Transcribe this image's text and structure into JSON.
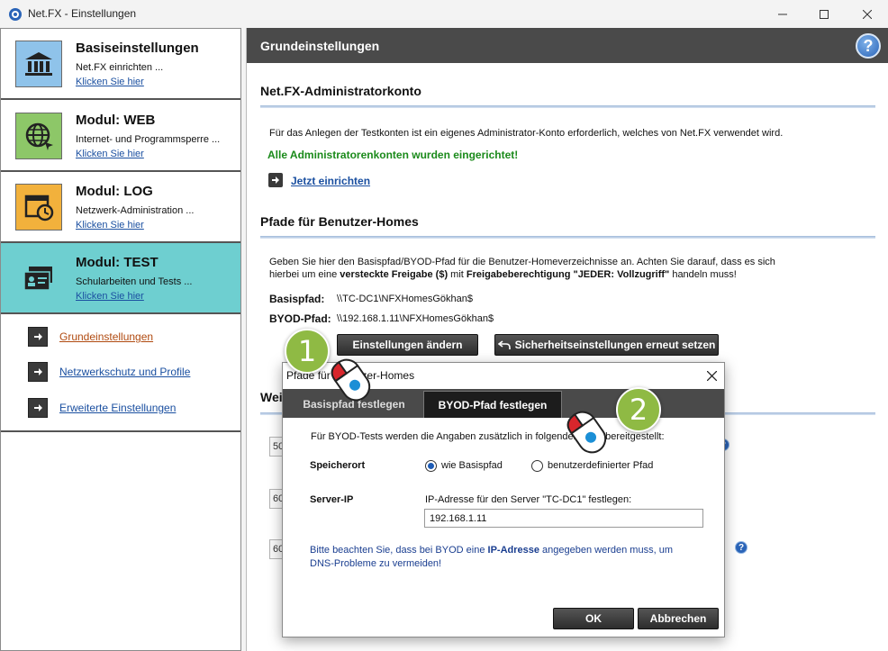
{
  "window": {
    "title": "Net.FX - Einstellungen"
  },
  "sidebar": {
    "modules": [
      {
        "title": "Basiseinstellungen",
        "desc": "Net.FX einrichten ...",
        "link": "Klicken Sie hier"
      },
      {
        "title": "Modul: WEB",
        "desc": "Internet- und Programmsperre ...",
        "link": "Klicken Sie hier"
      },
      {
        "title": "Modul: LOG",
        "desc": "Netzwerk-Administration ...",
        "link": "Klicken Sie hier"
      },
      {
        "title": "Modul: TEST",
        "desc": "Schularbeiten und Tests ...",
        "link": "Klicken Sie hier"
      }
    ],
    "nav": [
      {
        "label": "Grundeinstellungen"
      },
      {
        "label": "Netzwerkschutz und Profile"
      },
      {
        "label": "Erweiterte Einstellungen"
      }
    ]
  },
  "main": {
    "title": "Grundeinstellungen",
    "help": "?",
    "admin": {
      "heading": "Net.FX-Administratorkonto",
      "desc": "Für das Anlegen der Testkonten ist ein eigenes Administrator-Konto erforderlich, welches von Net.FX verwendet wird.",
      "status": "Alle Administratorenkonten wurden eingerichtet!",
      "action": "Jetzt einrichten"
    },
    "paths": {
      "heading": "Pfade für Benutzer-Homes",
      "desc_line1": "Geben Sie hier den Basispfad/BYOD-Pfad für die Benutzer-Homeverzeichnisse an. Achten Sie darauf, dass es sich",
      "desc_line2_a": "hierbei um eine ",
      "desc_line2_b": "versteckte Freigabe ($)",
      "desc_line2_c": " mit ",
      "desc_line2_d": "Freigabeberechtigung \"JEDER: Vollzugriff\"",
      "desc_line2_e": " handeln muss!",
      "base_label": "Basispfad:",
      "base_value": "\\\\TC-DC1\\NFXHomesGökhan$",
      "byod_label": "BYOD-Pfad:",
      "byod_value": "\\\\192.168.1.11\\NFXHomesGökhan$",
      "btn_change": "Einstellungen ändern",
      "btn_reset": "Sicherheitseinstellungen erneut setzen"
    },
    "more": {
      "heading_partial": "Wei",
      "field1": "50",
      "field2": "60",
      "field3": "60"
    }
  },
  "dialog": {
    "title": "Pfade für Benutzer-Homes",
    "tabs": [
      {
        "label": "Basispfad festlegen"
      },
      {
        "label": "BYOD-Pfad festlegen"
      }
    ],
    "intro": "Für BYOD-Tests werden die Angaben zusätzlich in folgender Form bereitgestellt:",
    "storage_label": "Speicherort",
    "radio_base": "wie Basispfad",
    "radio_custom": "benutzerdefinierter Pfad",
    "server_label": "Server-IP",
    "ip_caption": "IP-Adresse für den Server \"TC-DC1\" festlegen:",
    "ip_value": "192.168.1.11",
    "note_a": "Bitte beachten Sie, dass bei BYOD eine ",
    "note_b": "IP-Adresse",
    "note_c": " angegeben werden muss, um",
    "note_d": "DNS-Probleme zu vermeiden!",
    "ok": "OK",
    "cancel": "Abbrechen"
  },
  "callouts": {
    "one": "1",
    "two": "2"
  }
}
